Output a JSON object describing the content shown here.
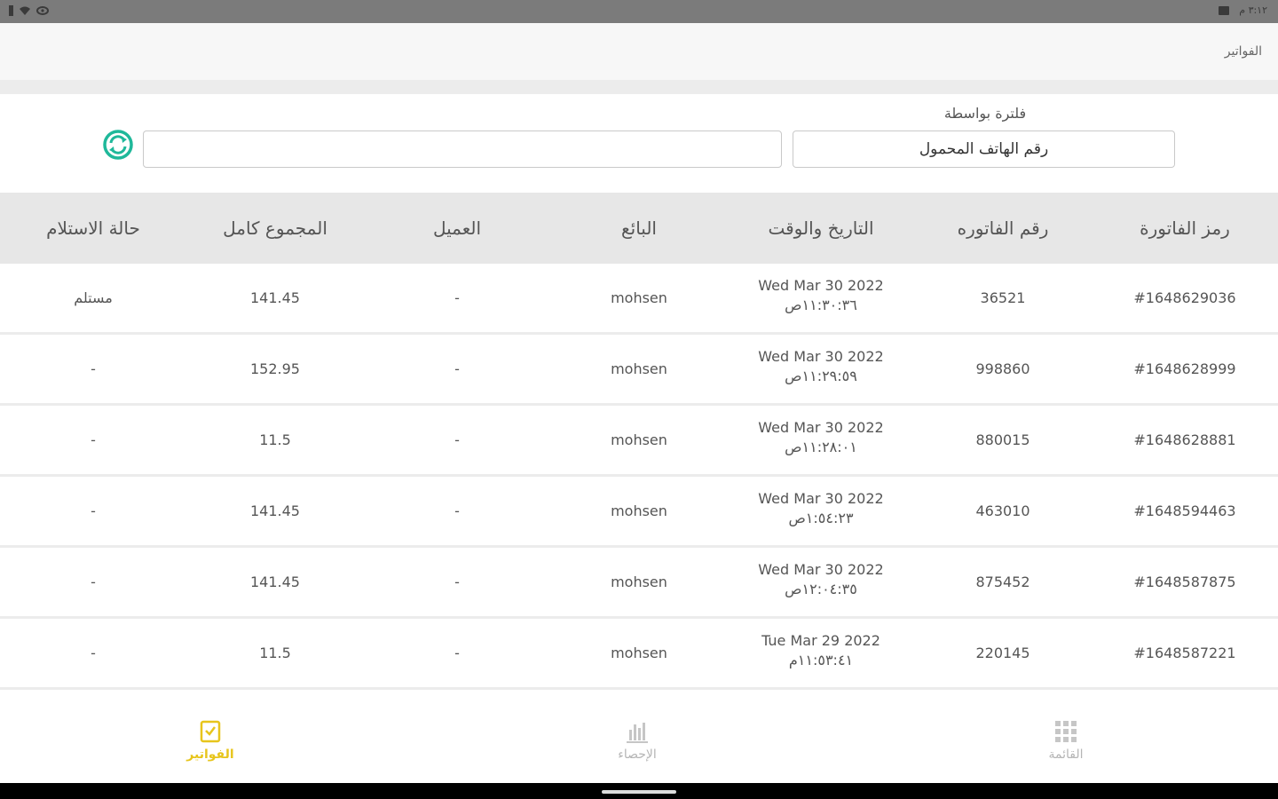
{
  "status_bar": {
    "time": "٣:١٢ م"
  },
  "header": {
    "title": "الفواتير"
  },
  "filter": {
    "label": "فلترة بواسطة",
    "selected": "رقم الهاتف المحمول",
    "search_value": ""
  },
  "table": {
    "columns": [
      "رمز الفاتورة",
      "رقم الفاتوره",
      "التاريخ والوقت",
      "البائع",
      "العميل",
      "المجموع كامل",
      "حالة الاستلام"
    ],
    "rows": [
      {
        "code": "#1648629036",
        "number": "36521",
        "date": "Wed Mar 30 2022",
        "time": "١١:٣٠:٣٦ص",
        "seller": "mohsen",
        "client": "-",
        "total": "141.45",
        "status": "مستلم"
      },
      {
        "code": "#1648628999",
        "number": "998860",
        "date": "Wed Mar 30 2022",
        "time": "١١:٢٩:٥٩ص",
        "seller": "mohsen",
        "client": "-",
        "total": "152.95",
        "status": "-"
      },
      {
        "code": "#1648628881",
        "number": "880015",
        "date": "Wed Mar 30 2022",
        "time": "١١:٢٨:٠١ص",
        "seller": "mohsen",
        "client": "-",
        "total": "11.5",
        "status": "-"
      },
      {
        "code": "#1648594463",
        "number": "463010",
        "date": "Wed Mar 30 2022",
        "time": "١:٥٤:٢٣ص",
        "seller": "mohsen",
        "client": "-",
        "total": "141.45",
        "status": "-"
      },
      {
        "code": "#1648587875",
        "number": "875452",
        "date": "Wed Mar 30 2022",
        "time": "١٢:٠٤:٣٥ص",
        "seller": "mohsen",
        "client": "-",
        "total": "141.45",
        "status": "-"
      },
      {
        "code": "#1648587221",
        "number": "220145",
        "date": "Tue Mar 29 2022",
        "time": "١١:٥٣:٤١م",
        "seller": "mohsen",
        "client": "-",
        "total": "11.5",
        "status": "-"
      }
    ]
  },
  "bottom_nav": {
    "menu_label": "القائمة",
    "stats_label": "الإحصاء",
    "invoices_label": "الفواتير",
    "active": "invoices"
  },
  "colors": {
    "accent": "#e7c51c",
    "refresh": "#1fb89a",
    "header_bg": "#e7e7e7"
  },
  "icons": {
    "refresh": "refresh-icon",
    "menu": "grid-icon",
    "stats": "bar-chart-icon",
    "invoices": "receipt-icon"
  }
}
